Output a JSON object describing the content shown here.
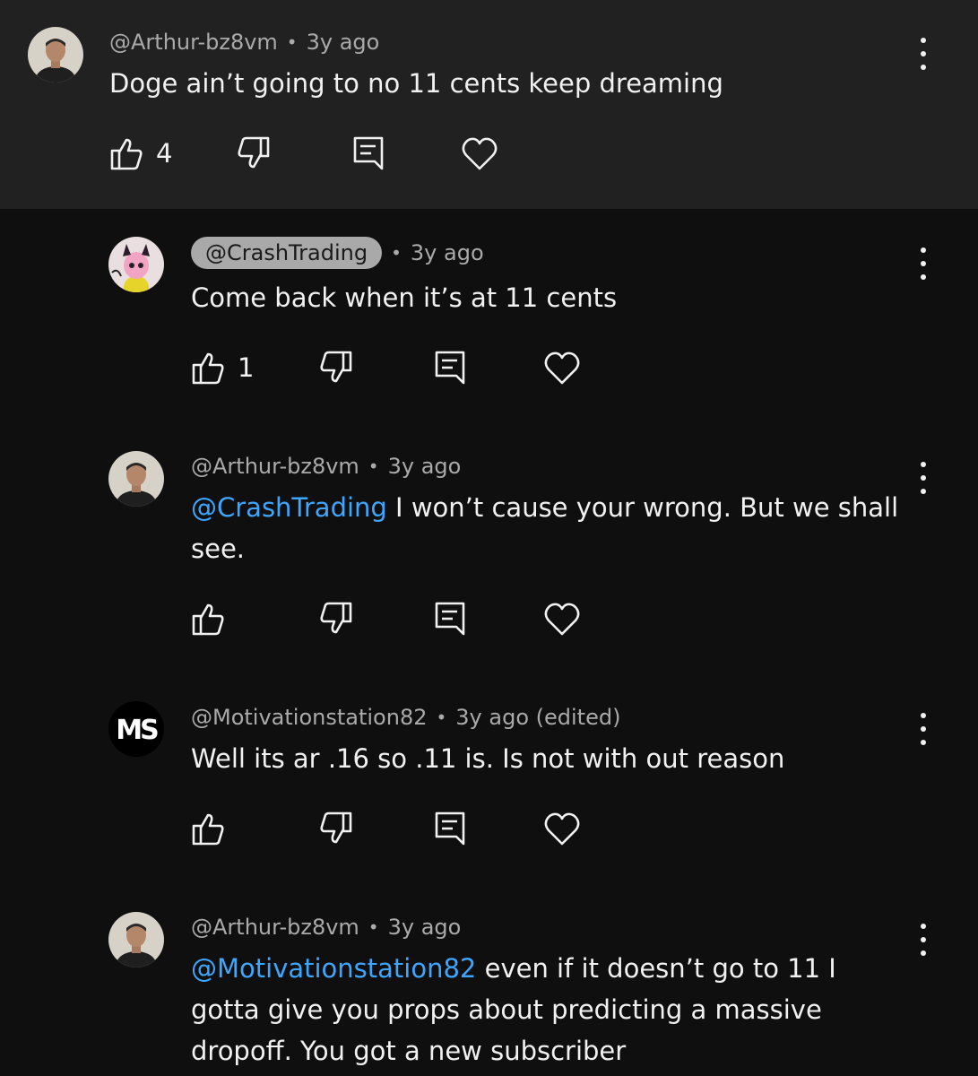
{
  "parent": {
    "author": "@Arthur-bz8vm",
    "separator": "•",
    "time": "3y ago",
    "text": "Doge ain’t going to no 11 cents keep dreaming",
    "likes": "4"
  },
  "replies": [
    {
      "author": "@CrashTrading",
      "author_is_creator_chip": true,
      "separator": "•",
      "time": "3y ago",
      "text": "Come back when it’s at 11 cents",
      "likes": "1"
    },
    {
      "author": "@Arthur-bz8vm",
      "separator": "•",
      "time": "3y ago",
      "mention": "@CrashTrading",
      "text": " I won’t cause your wrong. But we shall see.",
      "likes": ""
    },
    {
      "author": "@Motivationstation82",
      "separator": "•",
      "time": "3y ago (edited)",
      "text": "Well its ar .16 so .11 is. Is not with out reason",
      "likes": "",
      "avatar_letters": "MS"
    },
    {
      "author": "@Arthur-bz8vm",
      "separator": "•",
      "time": "3y ago",
      "mention": "@Motivationstation82",
      "text": " even if it doesn’t go to 11 I gotta give you props about predicting a massive dropoff. You got a new subscriber"
    }
  ],
  "icons": {
    "like": "thumbs-up-icon",
    "dislike": "thumbs-down-icon",
    "reply": "reply-icon",
    "heart": "heart-icon",
    "more": "more-vertical-icon"
  },
  "colors": {
    "background": "#0f0f0f",
    "parent_background": "#212121",
    "mention": "#3ea6ff",
    "meta": "#aaaaaa"
  }
}
